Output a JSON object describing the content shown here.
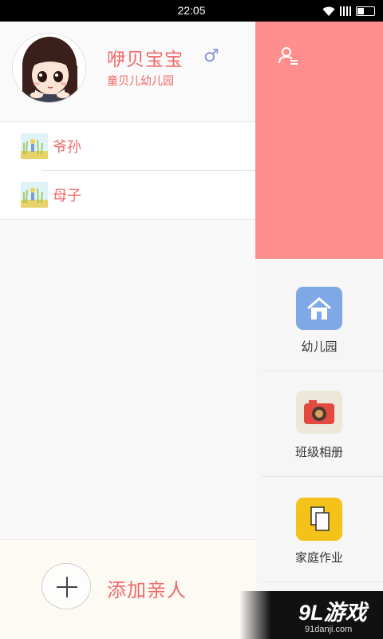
{
  "status_bar": {
    "time": "22:05"
  },
  "profile": {
    "name": "咿贝宝宝",
    "gender_symbol": "♂",
    "school": "童贝儿幼儿园",
    "gender_color": "#8a96d6"
  },
  "family": {
    "items": [
      {
        "label": "爷孙"
      },
      {
        "label": "母子"
      }
    ]
  },
  "add_relative": {
    "label": "添加亲人"
  },
  "menu": {
    "items": [
      {
        "label": "幼儿园",
        "icon": "home-icon"
      },
      {
        "label": "班级相册",
        "icon": "camera-icon"
      },
      {
        "label": "家庭作业",
        "icon": "homework-icon"
      }
    ]
  },
  "watermark": {
    "main": "9L游戏",
    "sub": "91danji.com"
  },
  "colors": {
    "accent": "#f06b6b",
    "header": "#ff8e8e",
    "home_tile": "#7fa8e6",
    "homework_tile": "#f5c21a"
  }
}
